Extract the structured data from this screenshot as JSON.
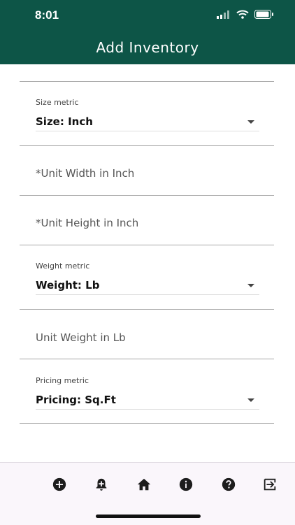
{
  "status_bar": {
    "time": "8:01"
  },
  "header": {
    "title": "Add Inventory"
  },
  "form": {
    "size": {
      "label": "Size metric",
      "value": "Size: Inch"
    },
    "unit_width": {
      "placeholder": "*Unit Width in Inch"
    },
    "unit_height": {
      "placeholder": "*Unit Height in Inch"
    },
    "weight": {
      "label": "Weight metric",
      "value": "Weight: Lb"
    },
    "unit_weight": {
      "placeholder": "Unit Weight in Lb"
    },
    "pricing": {
      "label": "Pricing metric",
      "value": "Pricing: Sq.Ft"
    }
  },
  "bottom_nav": {
    "items": [
      {
        "icon": "add-circle-icon"
      },
      {
        "icon": "add-alert-icon"
      },
      {
        "icon": "home-icon"
      },
      {
        "icon": "info-icon"
      },
      {
        "icon": "help-icon"
      },
      {
        "icon": "logout-icon"
      }
    ]
  },
  "colors": {
    "header_bg": "#0d5547",
    "nav_bg": "#faf6fb",
    "icon": "#1d1d1d"
  }
}
